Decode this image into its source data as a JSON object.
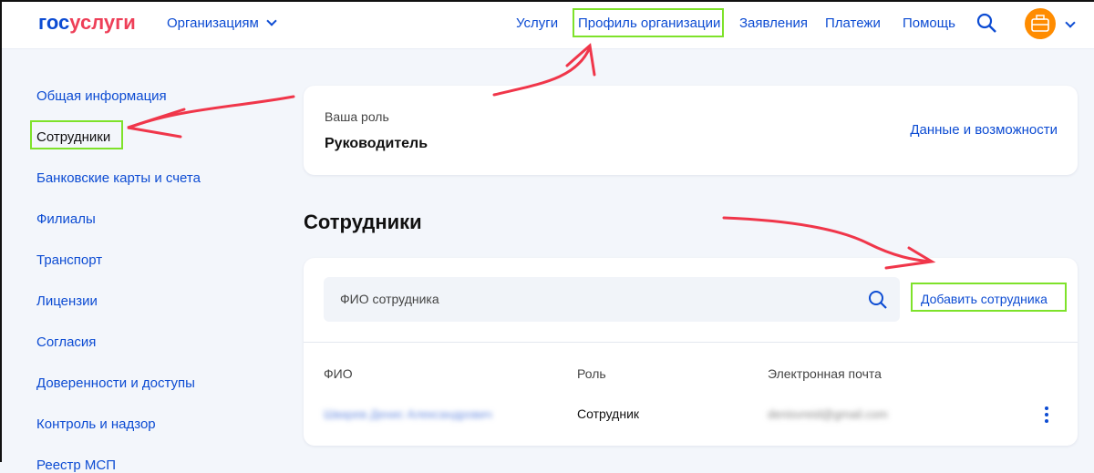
{
  "header": {
    "logo_part1": "гос",
    "logo_part2": "услуги",
    "orgs_menu": "Организациям",
    "nav": [
      "Услуги",
      "Профиль организации",
      "Заявления",
      "Платежи",
      "Помощь"
    ]
  },
  "sidebar": {
    "items": [
      "Общая информация",
      "Сотрудники",
      "Банковские карты и счета",
      "Филиалы",
      "Транспорт",
      "Лицензии",
      "Согласия",
      "Доверенности и доступы",
      "Контроль и надзор",
      "Реестр МСП"
    ]
  },
  "role_card": {
    "label": "Ваша роль",
    "value": "Руководитель",
    "link": "Данные и возможности"
  },
  "employees": {
    "title": "Сотрудники",
    "search_placeholder": "ФИО сотрудника",
    "add_button": "Добавить сотрудника",
    "columns": [
      "ФИО",
      "Роль",
      "Электронная почта"
    ],
    "rows": [
      {
        "name": "Шварев Денис Александрович",
        "role": "Сотрудник",
        "email": "denisvreid@gmail.com"
      }
    ]
  },
  "colors": {
    "accent": "#0d4cd3",
    "logo_red": "#ee3f58",
    "avatar": "#ff8c00",
    "annotation_arrow": "#f0364a",
    "annotation_box": "#7ee22a"
  }
}
